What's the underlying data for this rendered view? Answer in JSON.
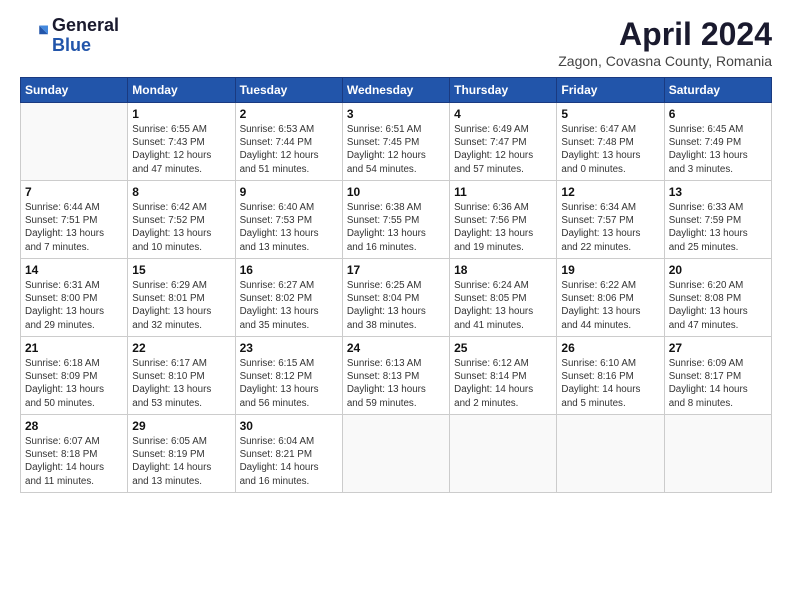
{
  "logo": {
    "general": "General",
    "blue": "Blue"
  },
  "header": {
    "title": "April 2024",
    "subtitle": "Zagon, Covasna County, Romania"
  },
  "weekdays": [
    "Sunday",
    "Monday",
    "Tuesday",
    "Wednesday",
    "Thursday",
    "Friday",
    "Saturday"
  ],
  "weeks": [
    [
      {
        "day": null,
        "info": null
      },
      {
        "day": "1",
        "info": "Sunrise: 6:55 AM\nSunset: 7:43 PM\nDaylight: 12 hours\nand 47 minutes."
      },
      {
        "day": "2",
        "info": "Sunrise: 6:53 AM\nSunset: 7:44 PM\nDaylight: 12 hours\nand 51 minutes."
      },
      {
        "day": "3",
        "info": "Sunrise: 6:51 AM\nSunset: 7:45 PM\nDaylight: 12 hours\nand 54 minutes."
      },
      {
        "day": "4",
        "info": "Sunrise: 6:49 AM\nSunset: 7:47 PM\nDaylight: 12 hours\nand 57 minutes."
      },
      {
        "day": "5",
        "info": "Sunrise: 6:47 AM\nSunset: 7:48 PM\nDaylight: 13 hours\nand 0 minutes."
      },
      {
        "day": "6",
        "info": "Sunrise: 6:45 AM\nSunset: 7:49 PM\nDaylight: 13 hours\nand 3 minutes."
      }
    ],
    [
      {
        "day": "7",
        "info": "Sunrise: 6:44 AM\nSunset: 7:51 PM\nDaylight: 13 hours\nand 7 minutes."
      },
      {
        "day": "8",
        "info": "Sunrise: 6:42 AM\nSunset: 7:52 PM\nDaylight: 13 hours\nand 10 minutes."
      },
      {
        "day": "9",
        "info": "Sunrise: 6:40 AM\nSunset: 7:53 PM\nDaylight: 13 hours\nand 13 minutes."
      },
      {
        "day": "10",
        "info": "Sunrise: 6:38 AM\nSunset: 7:55 PM\nDaylight: 13 hours\nand 16 minutes."
      },
      {
        "day": "11",
        "info": "Sunrise: 6:36 AM\nSunset: 7:56 PM\nDaylight: 13 hours\nand 19 minutes."
      },
      {
        "day": "12",
        "info": "Sunrise: 6:34 AM\nSunset: 7:57 PM\nDaylight: 13 hours\nand 22 minutes."
      },
      {
        "day": "13",
        "info": "Sunrise: 6:33 AM\nSunset: 7:59 PM\nDaylight: 13 hours\nand 25 minutes."
      }
    ],
    [
      {
        "day": "14",
        "info": "Sunrise: 6:31 AM\nSunset: 8:00 PM\nDaylight: 13 hours\nand 29 minutes."
      },
      {
        "day": "15",
        "info": "Sunrise: 6:29 AM\nSunset: 8:01 PM\nDaylight: 13 hours\nand 32 minutes."
      },
      {
        "day": "16",
        "info": "Sunrise: 6:27 AM\nSunset: 8:02 PM\nDaylight: 13 hours\nand 35 minutes."
      },
      {
        "day": "17",
        "info": "Sunrise: 6:25 AM\nSunset: 8:04 PM\nDaylight: 13 hours\nand 38 minutes."
      },
      {
        "day": "18",
        "info": "Sunrise: 6:24 AM\nSunset: 8:05 PM\nDaylight: 13 hours\nand 41 minutes."
      },
      {
        "day": "19",
        "info": "Sunrise: 6:22 AM\nSunset: 8:06 PM\nDaylight: 13 hours\nand 44 minutes."
      },
      {
        "day": "20",
        "info": "Sunrise: 6:20 AM\nSunset: 8:08 PM\nDaylight: 13 hours\nand 47 minutes."
      }
    ],
    [
      {
        "day": "21",
        "info": "Sunrise: 6:18 AM\nSunset: 8:09 PM\nDaylight: 13 hours\nand 50 minutes."
      },
      {
        "day": "22",
        "info": "Sunrise: 6:17 AM\nSunset: 8:10 PM\nDaylight: 13 hours\nand 53 minutes."
      },
      {
        "day": "23",
        "info": "Sunrise: 6:15 AM\nSunset: 8:12 PM\nDaylight: 13 hours\nand 56 minutes."
      },
      {
        "day": "24",
        "info": "Sunrise: 6:13 AM\nSunset: 8:13 PM\nDaylight: 13 hours\nand 59 minutes."
      },
      {
        "day": "25",
        "info": "Sunrise: 6:12 AM\nSunset: 8:14 PM\nDaylight: 14 hours\nand 2 minutes."
      },
      {
        "day": "26",
        "info": "Sunrise: 6:10 AM\nSunset: 8:16 PM\nDaylight: 14 hours\nand 5 minutes."
      },
      {
        "day": "27",
        "info": "Sunrise: 6:09 AM\nSunset: 8:17 PM\nDaylight: 14 hours\nand 8 minutes."
      }
    ],
    [
      {
        "day": "28",
        "info": "Sunrise: 6:07 AM\nSunset: 8:18 PM\nDaylight: 14 hours\nand 11 minutes."
      },
      {
        "day": "29",
        "info": "Sunrise: 6:05 AM\nSunset: 8:19 PM\nDaylight: 14 hours\nand 13 minutes."
      },
      {
        "day": "30",
        "info": "Sunrise: 6:04 AM\nSunset: 8:21 PM\nDaylight: 14 hours\nand 16 minutes."
      },
      {
        "day": null,
        "info": null
      },
      {
        "day": null,
        "info": null
      },
      {
        "day": null,
        "info": null
      },
      {
        "day": null,
        "info": null
      }
    ]
  ]
}
